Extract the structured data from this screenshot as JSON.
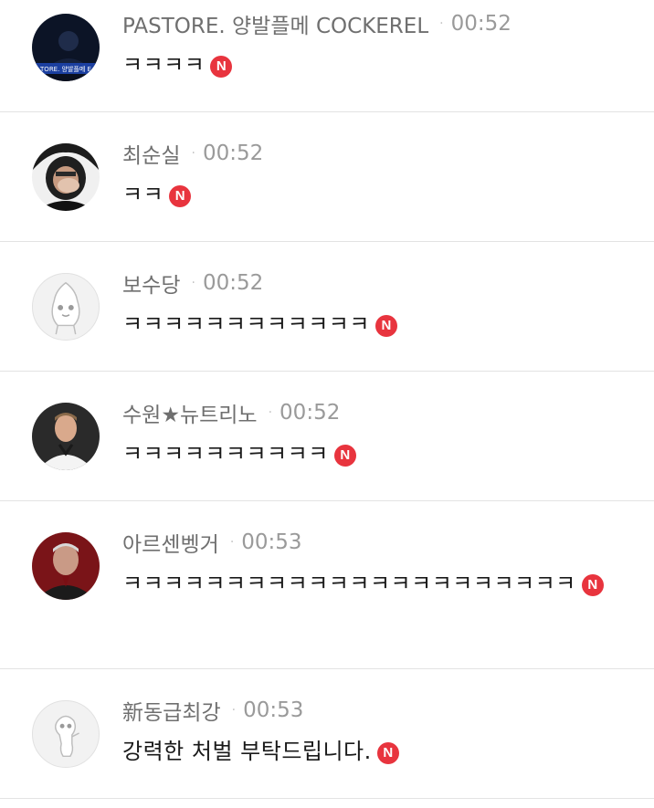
{
  "comments": [
    {
      "nickname": "PASTORE. 양발플메 COCKEREL",
      "separator": "·",
      "time": "00:52",
      "text": "ㅋㅋㅋㅋ",
      "badge": "N",
      "avatar_text": "TORE. 양발플메 E"
    },
    {
      "nickname": "최순실",
      "separator": "·",
      "time": "00:52",
      "text": "ㅋㅋ",
      "badge": "N"
    },
    {
      "nickname": "보수당",
      "separator": "·",
      "time": "00:52",
      "text": "ㅋㅋㅋㅋㅋㅋㅋㅋㅋㅋㅋㅋ",
      "badge": "N"
    },
    {
      "nickname_prefix": "수원",
      "nickname_star": "★",
      "nickname_suffix": "뉴트리노",
      "separator": "·",
      "time": "00:52",
      "text": "ㅋㅋㅋㅋㅋㅋㅋㅋㅋㅋ",
      "badge": "N"
    },
    {
      "nickname": "아르센벵거",
      "separator": "·",
      "time": "00:53",
      "text": "ㅋㅋㅋㅋㅋㅋㅋㅋㅋㅋㅋㅋㅋㅋㅋㅋㅋㅋㅋㅋㅋㅋ",
      "badge": "N"
    },
    {
      "nickname": "新동급최강",
      "separator": "·",
      "time": "00:53",
      "text": "강력한 처벌 부탁드립니다.",
      "badge": "N"
    }
  ],
  "colors": {
    "badge": "#e8343e",
    "nickname": "#6f6f6f",
    "time": "#9a9a9a",
    "divider": "#e3e3e3"
  }
}
